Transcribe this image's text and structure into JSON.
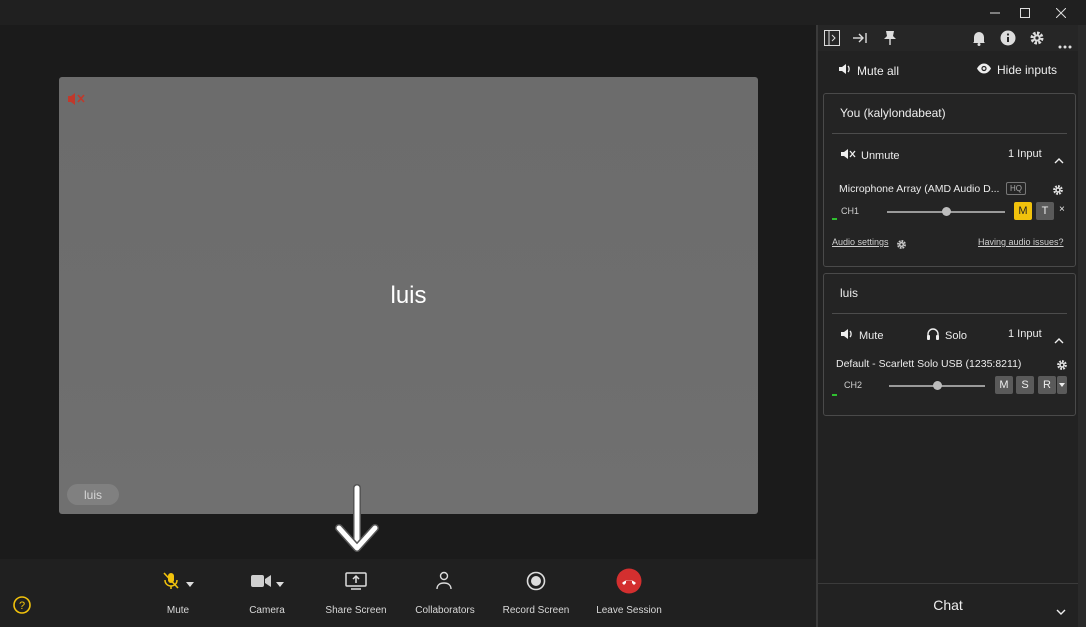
{
  "window": {
    "controls": [
      "minimize-icon",
      "maximize-icon",
      "close-icon"
    ]
  },
  "stage": {
    "participant_name": "luis",
    "badge_name": "luis"
  },
  "toolbar": {
    "mute": "Mute",
    "camera": "Camera",
    "share": "Share Screen",
    "collaborators": "Collaborators",
    "record": "Record Screen",
    "leave": "Leave Session"
  },
  "sidebar": {
    "mute_all": "Mute all",
    "hide_inputs": "Hide inputs",
    "you": {
      "title": "You (kalylondabeat)",
      "unmute": "Unmute",
      "input_count": "1 Input",
      "device": "Microphone Array (AMD Audio D...",
      "hq": "HQ",
      "channel": "CH1",
      "m": "M",
      "t": "T",
      "x": "×",
      "audio_settings": "Audio settings",
      "having_issues": "Having audio issues?",
      "slider_level": 0.5
    },
    "luis": {
      "title": "luis",
      "mute": "Mute",
      "solo": "Solo",
      "input_count": "1 Input",
      "device": "Default - Scarlett Solo USB (1235:8211)",
      "channel": "CH2",
      "m": "M",
      "s": "S",
      "r": "R",
      "slider_level": 0.5
    },
    "chat": "Chat"
  },
  "colors": {
    "accent_yellow": "#f1c20c",
    "leave_red": "#d32f2f",
    "mute_icon_red": "#c0392b"
  }
}
